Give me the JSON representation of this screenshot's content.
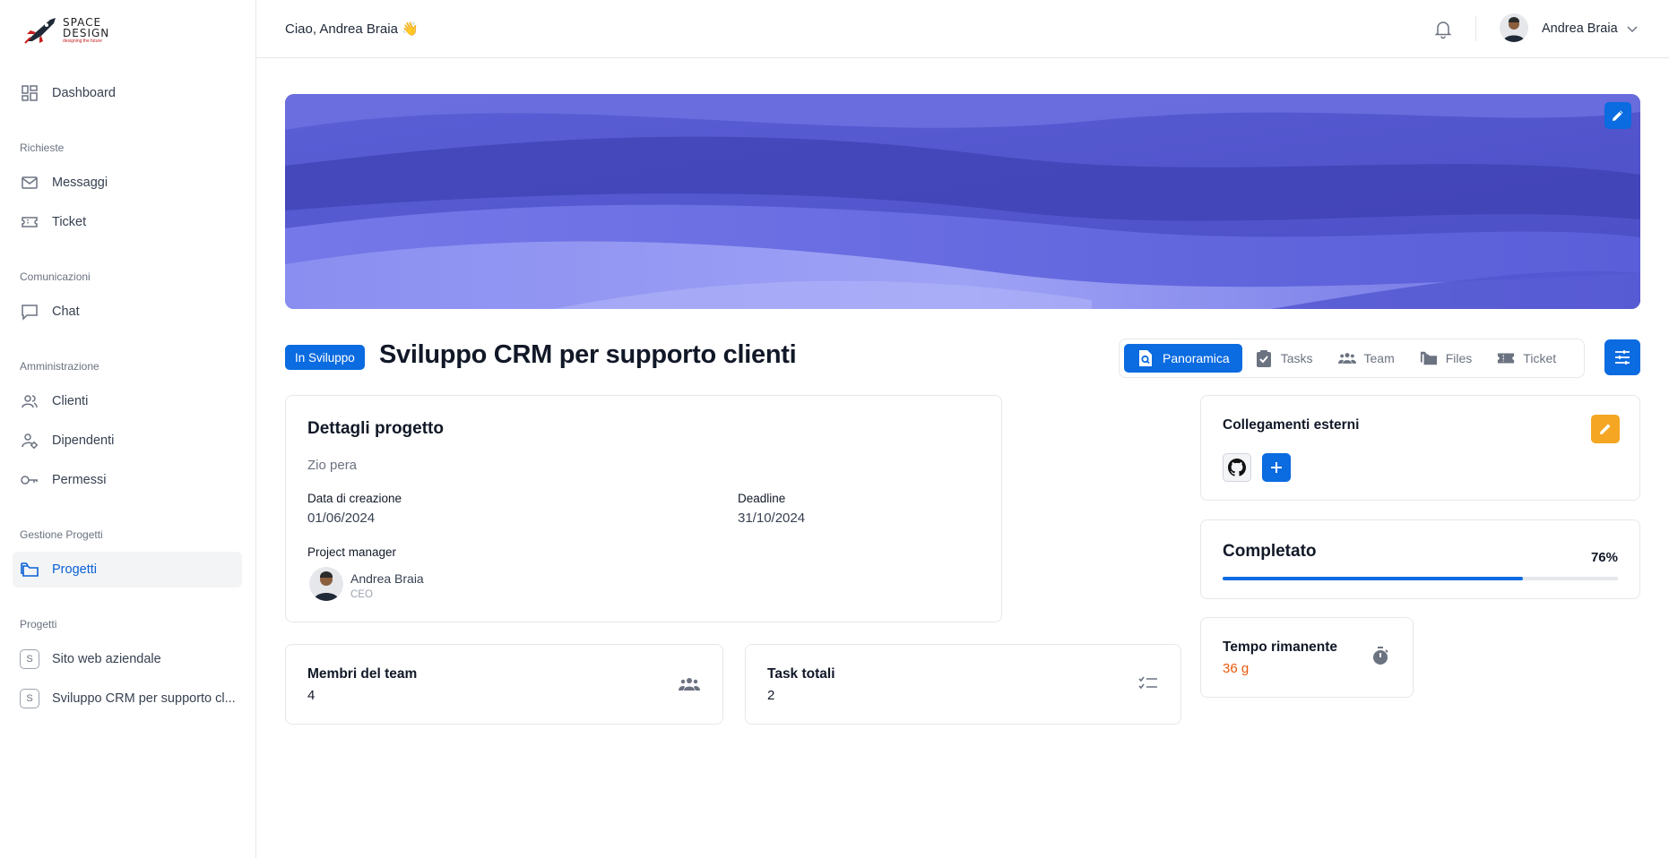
{
  "sidebar": {
    "logo": {
      "line1": "SPACE",
      "line2": "DESIGN",
      "tagline": "designing the future"
    },
    "dashboard": "Dashboard",
    "sections": {
      "richieste": "Richieste",
      "comunicazioni": "Comunicazioni",
      "amministrazione": "Amministrazione",
      "gestione": "Gestione Progetti",
      "progetti": "Progetti"
    },
    "items": {
      "messaggi": "Messaggi",
      "ticket": "Ticket",
      "chat": "Chat",
      "clienti": "Clienti",
      "dipendenti": "Dipendenti",
      "permessi": "Permessi",
      "progetti": "Progetti"
    },
    "projects": [
      {
        "badge": "S",
        "label": "Sito web aziendale"
      },
      {
        "badge": "S",
        "label": "Sviluppo CRM per supporto cl..."
      }
    ]
  },
  "header": {
    "greeting": "Ciao, Andrea Braia 👋",
    "user_name": "Andrea Braia"
  },
  "project": {
    "status": "In Sviluppo",
    "title": "Sviluppo CRM per supporto clienti"
  },
  "tabs": [
    "Panoramica",
    "Tasks",
    "Team",
    "Files",
    "Ticket"
  ],
  "details": {
    "title": "Dettagli progetto",
    "description": "Zio pera",
    "created_label": "Data di creazione",
    "created_value": "01/06/2024",
    "deadline_label": "Deadline",
    "deadline_value": "31/10/2024",
    "pm_label": "Project manager",
    "pm_name": "Andrea Braia",
    "pm_role": "CEO"
  },
  "team_card": {
    "label": "Membri del team",
    "value": "4"
  },
  "tasks_card": {
    "label": "Task totali",
    "value": "2"
  },
  "links_card": {
    "title": "Collegamenti esterni"
  },
  "progress_card": {
    "title": "Completato",
    "percent_label": "76%",
    "percent": 0.76
  },
  "time_card": {
    "label": "Tempo rimanente",
    "value": "36 g"
  },
  "colors": {
    "primary": "#0b6be0",
    "warning": "#f5a623",
    "accent_orange": "#ea580c"
  }
}
